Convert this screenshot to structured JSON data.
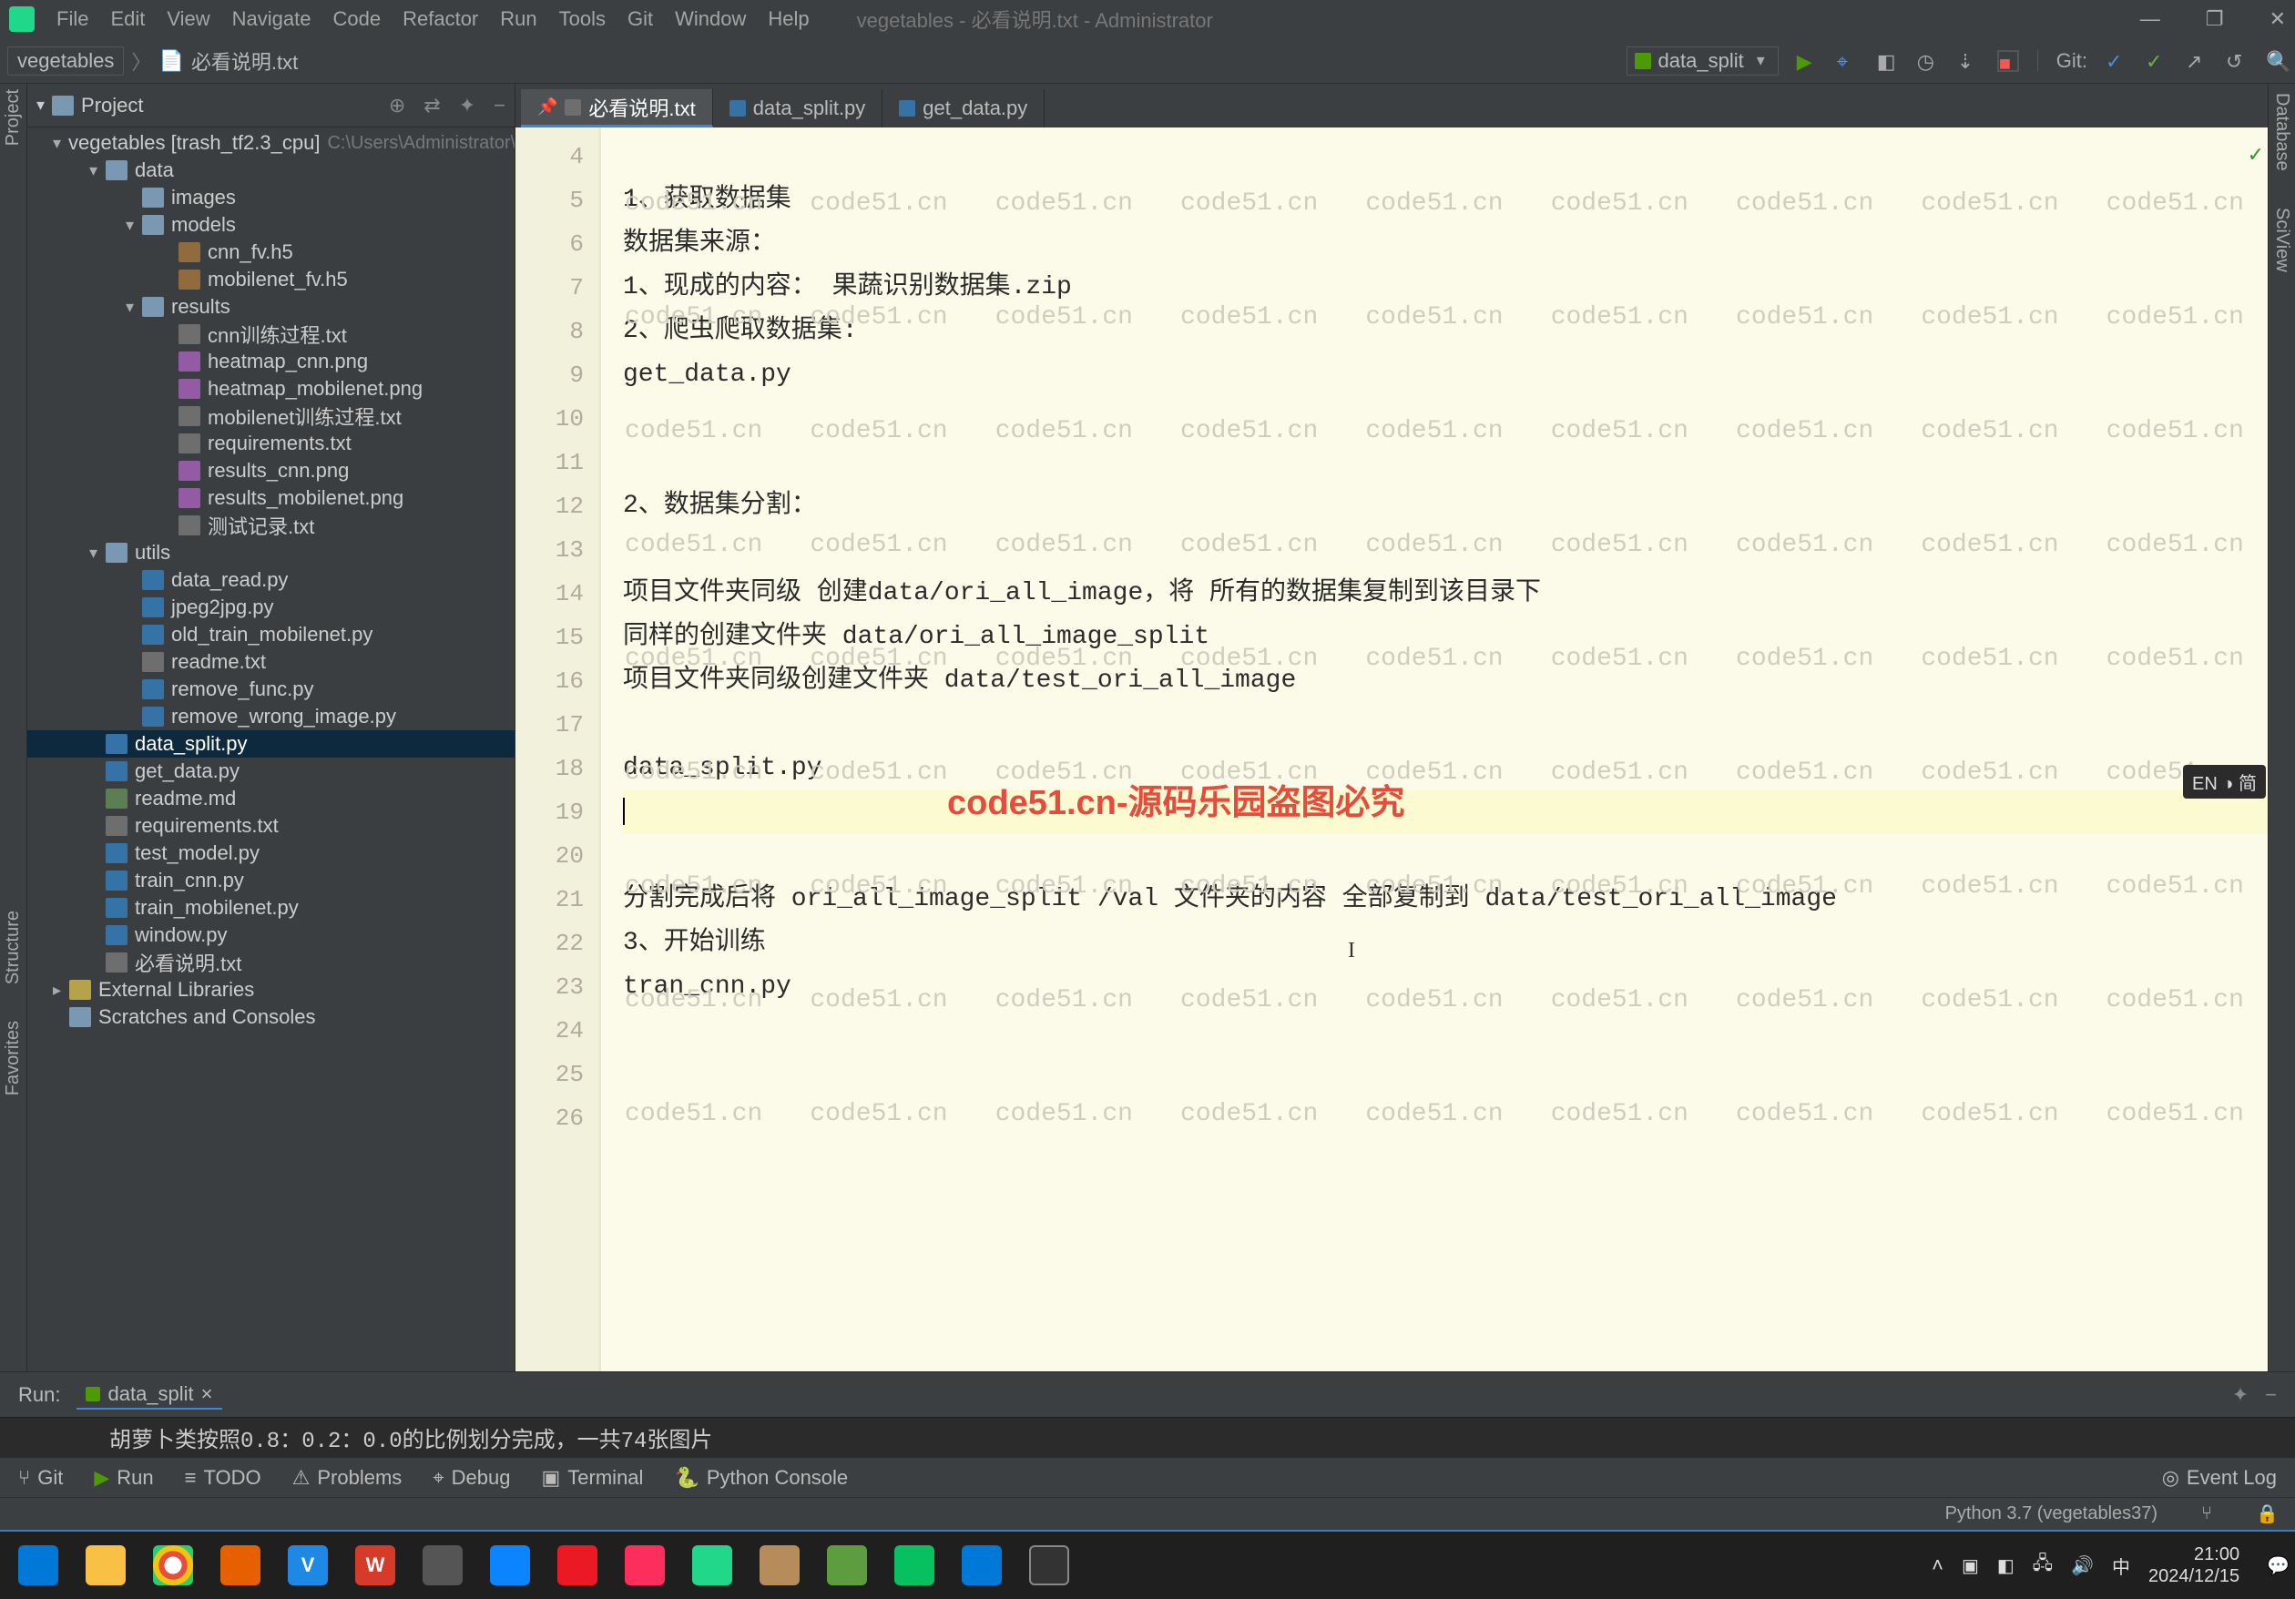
{
  "window": {
    "title": "vegetables - 必看说明.txt - Administrator"
  },
  "menu": {
    "file": "File",
    "edit": "Edit",
    "view": "View",
    "navigate": "Navigate",
    "code": "Code",
    "refactor": "Refactor",
    "run": "Run",
    "tools": "Tools",
    "git": "Git",
    "window": "Window",
    "help": "Help"
  },
  "win_controls": {
    "min": "—",
    "max": "❐",
    "close": "✕"
  },
  "breadcrumb": {
    "root": "vegetables",
    "file": "必看说明.txt"
  },
  "run_config": {
    "name": "data_split",
    "git_label": "Git:"
  },
  "project": {
    "header": "Project",
    "root": "vegetables [trash_tf2.3_cpu]",
    "root_path": "C:\\Users\\Administrator\\...",
    "tree": [
      {
        "level": 1,
        "exp": "open",
        "icon": "folder",
        "label": "data"
      },
      {
        "level": 2,
        "exp": "",
        "icon": "folder",
        "label": "images"
      },
      {
        "level": 2,
        "exp": "open",
        "icon": "folder",
        "label": "models"
      },
      {
        "level": 3,
        "exp": "",
        "icon": "h5",
        "label": "cnn_fv.h5"
      },
      {
        "level": 3,
        "exp": "",
        "icon": "h5",
        "label": "mobilenet_fv.h5"
      },
      {
        "level": 2,
        "exp": "open",
        "icon": "folder",
        "label": "results"
      },
      {
        "level": 3,
        "exp": "",
        "icon": "txt",
        "label": "cnn训练过程.txt"
      },
      {
        "level": 3,
        "exp": "",
        "icon": "img",
        "label": "heatmap_cnn.png"
      },
      {
        "level": 3,
        "exp": "",
        "icon": "img",
        "label": "heatmap_mobilenet.png"
      },
      {
        "level": 3,
        "exp": "",
        "icon": "txt",
        "label": "mobilenet训练过程.txt"
      },
      {
        "level": 3,
        "exp": "",
        "icon": "txt",
        "label": "requirements.txt"
      },
      {
        "level": 3,
        "exp": "",
        "icon": "img",
        "label": "results_cnn.png"
      },
      {
        "level": 3,
        "exp": "",
        "icon": "img",
        "label": "results_mobilenet.png"
      },
      {
        "level": 3,
        "exp": "",
        "icon": "txt",
        "label": "测试记录.txt"
      },
      {
        "level": 1,
        "exp": "open",
        "icon": "folder",
        "label": "utils"
      },
      {
        "level": 2,
        "exp": "",
        "icon": "py",
        "label": "data_read.py"
      },
      {
        "level": 2,
        "exp": "",
        "icon": "py",
        "label": "jpeg2jpg.py"
      },
      {
        "level": 2,
        "exp": "",
        "icon": "py",
        "label": "old_train_mobilenet.py"
      },
      {
        "level": 2,
        "exp": "",
        "icon": "txt",
        "label": "readme.txt"
      },
      {
        "level": 2,
        "exp": "",
        "icon": "py",
        "label": "remove_func.py"
      },
      {
        "level": 2,
        "exp": "",
        "icon": "py",
        "label": "remove_wrong_image.py"
      },
      {
        "level": 1,
        "exp": "",
        "icon": "py",
        "label": "data_split.py",
        "selected": true
      },
      {
        "level": 1,
        "exp": "",
        "icon": "py",
        "label": "get_data.py"
      },
      {
        "level": 1,
        "exp": "",
        "icon": "md",
        "label": "readme.md"
      },
      {
        "level": 1,
        "exp": "",
        "icon": "txt",
        "label": "requirements.txt"
      },
      {
        "level": 1,
        "exp": "",
        "icon": "py",
        "label": "test_model.py"
      },
      {
        "level": 1,
        "exp": "",
        "icon": "py",
        "label": "train_cnn.py"
      },
      {
        "level": 1,
        "exp": "",
        "icon": "py",
        "label": "train_mobilenet.py"
      },
      {
        "level": 1,
        "exp": "",
        "icon": "py",
        "label": "window.py"
      },
      {
        "level": 1,
        "exp": "",
        "icon": "txt",
        "label": "必看说明.txt"
      }
    ],
    "external": "External Libraries",
    "scratches": "Scratches and Consoles"
  },
  "tabs": [
    {
      "label": "必看说明.txt",
      "icon": "txt",
      "active": true,
      "pinned": true
    },
    {
      "label": "data_split.py",
      "icon": "py",
      "active": false
    },
    {
      "label": "get_data.py",
      "icon": "py",
      "active": false
    }
  ],
  "gutter_start": 4,
  "gutter_end": 26,
  "editor_lines": {
    "l4": "",
    "l5": "1、获取数据集",
    "l6": "数据集来源：",
    "l7": "1、现成的内容：  果蔬识别数据集.zip",
    "l8": "2、爬虫爬取数据集:",
    "l9": "get_data.py",
    "l10": "",
    "l11": "",
    "l12": "2、数据集分割：",
    "l13": "",
    "l14": "项目文件夹同级  创建data/ori_all_image，将  所有的数据集复制到该目录下",
    "l15": "同样的创建文件夹 data/ori_all_image_split",
    "l16": "项目文件夹同级创建文件夹 data/test_ori_all_image",
    "l17": "",
    "l18": "data_split.py",
    "l19": "",
    "l20": "",
    "l21": "分割完成后将   ori_all_image_split /val 文件夹的内容  全部复制到  data/test_ori_all_image",
    "l22": "3、开始训练",
    "l23": "tran_cnn.py",
    "l24": "",
    "l25": "",
    "l26": ""
  },
  "watermark_text": "code51.cn",
  "red_overlay": "code51.cn-源码乐园盗图必究",
  "lang_pill": "EN ◑ 简",
  "run_panel": {
    "label": "Run:",
    "config": "data_split",
    "close": "×"
  },
  "run_output": "胡萝卜类按照0.8：0.2：0.0的比例划分完成，一共74张图片",
  "bottom_tools": {
    "git": "Git",
    "run": "Run",
    "todo": "TODO",
    "problems": "Problems",
    "debug": "Debug",
    "terminal": "Terminal",
    "pyconsole": "Python Console",
    "event_log": "Event Log"
  },
  "status": {
    "encoding": "",
    "python": "Python 3.7 (vegetables37)",
    "branch": ""
  },
  "left_rail": {
    "project": "Project",
    "structure": "Structure",
    "favorites": "Favorites"
  },
  "right_rail": {
    "database": "Database",
    "sciview": "SciView"
  },
  "taskbar": {
    "time": "21:00",
    "date": "2024/12/15"
  }
}
